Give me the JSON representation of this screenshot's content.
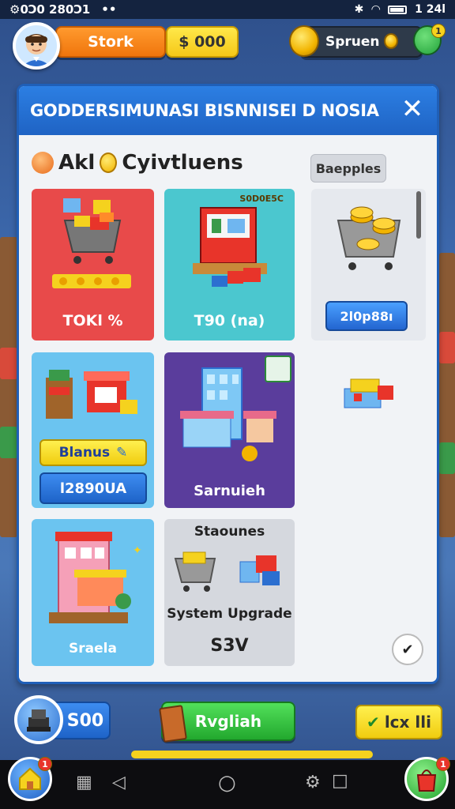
{
  "status_bar": {
    "left_text": "⚙0Ͻ0 280Ͻ1",
    "dots": "••",
    "time": "1 24l"
  },
  "hud": {
    "orange_label": "Stork",
    "yellow_label": "$ 000",
    "right_label": "Spruen",
    "notif_count": "1"
  },
  "panel": {
    "title": "GODDERSIMUNASI BISNNISEI D NOSIA",
    "close_glyph": "✕",
    "subtitle_pre": "Akl",
    "subtitle_post": "Cyivtluens",
    "search_label": "Baepples"
  },
  "cards": {
    "red": {
      "label": "TOKl %"
    },
    "teal": {
      "tag": "S0D0E5C",
      "label": "T90 (na)"
    },
    "coins": {
      "button": "2l0p88ı"
    },
    "blue": {
      "badge": "Blanus",
      "value": "l2890UA"
    },
    "purple": {
      "label": "Sarnuieh"
    },
    "pink": {
      "label": "Sraela"
    },
    "grey": {
      "title": "Staounes",
      "subtitle": "System Upgrade",
      "price": "S3V"
    }
  },
  "bottom": {
    "coin_value": "S00",
    "green_label": "Rvgliah",
    "yellow_label": "lcx lli",
    "yellow_check": "✔"
  },
  "nav": {
    "back": "◁",
    "home": "○",
    "recent": "□",
    "home_notif": "1",
    "bag_notif": "1"
  },
  "colors": {
    "header_blue": "#1f63c4",
    "card_red": "#e84a4a",
    "card_teal": "#4bc7cf",
    "card_lightblue": "#6bc4f0",
    "card_purple": "#5a3d9c",
    "accent_yellow": "#f5d21e",
    "accent_green": "#22a82e"
  }
}
